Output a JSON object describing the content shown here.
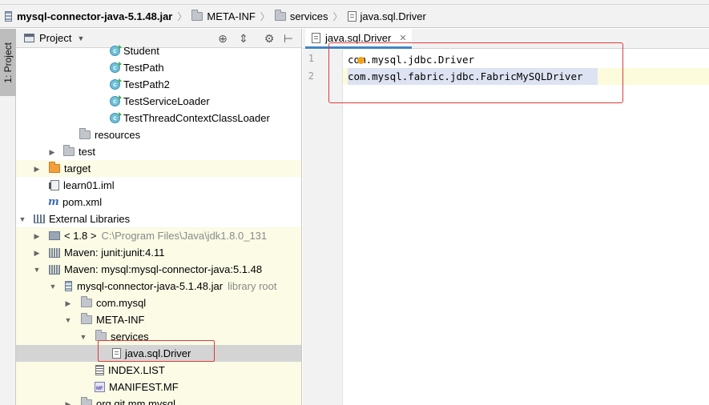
{
  "breadcrumb": [
    {
      "label": "mysql-connector-java-5.1.48.jar",
      "icon": "jar-icon",
      "bold": true
    },
    {
      "label": "META-INF",
      "icon": "folder-icon",
      "bold": false
    },
    {
      "label": "services",
      "icon": "folder-icon",
      "bold": false
    },
    {
      "label": "java.sql.Driver",
      "icon": "file-icon",
      "bold": false
    }
  ],
  "tool_window": {
    "tab_label": "1: Project"
  },
  "project_panel": {
    "title": "Project",
    "tools": {
      "locate": "locate-icon",
      "collapse": "collapse-all-icon",
      "settings": "gear-icon",
      "hide": "hide-icon"
    }
  },
  "tree": [
    {
      "label": "Student",
      "icon": "class-icon"
    },
    {
      "label": "TestPath",
      "icon": "class-icon"
    },
    {
      "label": "TestPath2",
      "icon": "class-icon"
    },
    {
      "label": "TestServiceLoader",
      "icon": "class-icon"
    },
    {
      "label": "TestThreadContextClassLoader",
      "icon": "class-icon"
    },
    {
      "label": "resources",
      "icon": "folder-icon"
    },
    {
      "label": "test",
      "icon": "folder-icon"
    },
    {
      "label": "target",
      "icon": "folder-icon"
    },
    {
      "label": "learn01.iml",
      "icon": "iml-icon"
    },
    {
      "label": "pom.xml",
      "icon": "maven-icon"
    },
    {
      "label": "External Libraries",
      "icon": "library-icon"
    },
    {
      "label": "< 1.8 >",
      "hint": "C:\\Program Files\\Java\\jdk1.8.0_131",
      "icon": "jdk-icon"
    },
    {
      "label": "Maven: junit:junit:4.11",
      "icon": "library-icon"
    },
    {
      "label": "Maven: mysql:mysql-connector-java:5.1.48",
      "icon": "library-icon"
    },
    {
      "label": "mysql-connector-java-5.1.48.jar",
      "hint": "library root",
      "icon": "jar-icon"
    },
    {
      "label": "com.mysql",
      "icon": "package-icon"
    },
    {
      "label": "META-INF",
      "icon": "folder-icon"
    },
    {
      "label": "services",
      "icon": "folder-icon"
    },
    {
      "label": "java.sql.Driver",
      "icon": "file-icon"
    },
    {
      "label": "INDEX.LIST",
      "icon": "list-file-icon"
    },
    {
      "label": "MANIFEST.MF",
      "icon": "manifest-icon",
      "badge": "MF"
    },
    {
      "label": "org.gjt.mm.mysql",
      "icon": "package-icon"
    }
  ],
  "editor": {
    "tab_label": "java.sql.Driver",
    "line_numbers": [
      "1",
      "2"
    ],
    "lines": [
      "com.mysql.jdbc.Driver",
      "com.mysql.fabric.jdbc.FabricMySQLDriver"
    ]
  },
  "colors": {
    "accent": "#4083c9",
    "highlight_box": "#e03a3a",
    "selection": "#d4d4d4",
    "library_bg": "#fbfbe6"
  }
}
